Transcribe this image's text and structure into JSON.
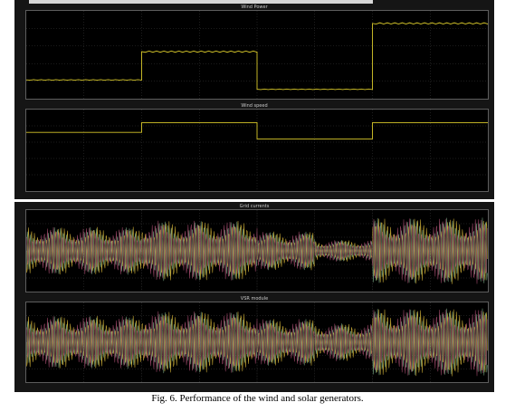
{
  "caption": "Fig. 6. Performance of the wind and solar generators.",
  "chart_data": [
    {
      "type": "line",
      "title": "Wind Power",
      "x": [
        0,
        2,
        2,
        4,
        4,
        6,
        6,
        8
      ],
      "series": [
        {
          "values": [
            3,
            3,
            7.5,
            7.5,
            1.5,
            1.5,
            12,
            12
          ]
        }
      ],
      "color": "#d7c72a",
      "xlim": [
        0,
        8
      ]
    },
    {
      "type": "line",
      "title": "Wind speed",
      "x": [
        0,
        2,
        2,
        4,
        4,
        6,
        6,
        8
      ],
      "series": [
        {
          "values": [
            1.8,
            1.8,
            2.1,
            2.1,
            1.6,
            1.6,
            2.1,
            2.1
          ]
        }
      ],
      "color": "#d7c72a",
      "xlim": [
        0,
        8
      ],
      "ylim": [
        0,
        2.5
      ]
    },
    {
      "type": "line",
      "title": "Grid currents",
      "x": [
        0,
        2,
        4,
        5,
        6,
        8
      ],
      "series": [
        {
          "values": [
            0.62,
            0.78,
            0.5,
            0.28,
            0.86
          ]
        }
      ],
      "colors": [
        "#d9b83a",
        "#7fb28c",
        "#a54d6f"
      ],
      "xlim": [
        0,
        8
      ]
    },
    {
      "type": "line",
      "title": "VSR module",
      "x": [
        0,
        2,
        4,
        5,
        6,
        8
      ],
      "series": [
        {
          "values": [
            0.7,
            0.82,
            0.62,
            0.5,
            0.9
          ]
        }
      ],
      "colors": [
        "#d9b83a",
        "#7fb28c",
        "#a54d6f"
      ],
      "xlim": [
        0,
        8
      ]
    }
  ]
}
